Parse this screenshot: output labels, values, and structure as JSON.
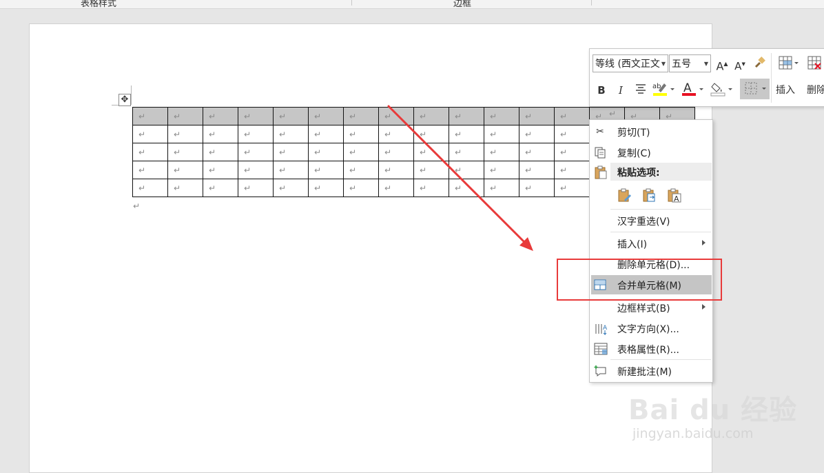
{
  "ribbon": {
    "group_table_styles": "表格样式",
    "group_borders": "边框"
  },
  "document": {
    "move_handle_icon": "move-icon",
    "paragraph_mark": "↵",
    "table_rows": 5,
    "table_cols": 16,
    "selected_row": 1
  },
  "mini_toolbar": {
    "font_name": "等线 (西文正文",
    "font_size": "五号",
    "grow_font": "A",
    "shrink_font": "A",
    "bold": "B",
    "italic": "I",
    "font_color_letter": "A",
    "insert_label": "插入",
    "delete_label": "删除"
  },
  "context_menu": {
    "items": [
      {
        "label": "剪切(T)",
        "icon": "cut-icon"
      },
      {
        "label": "复制(C)",
        "icon": "copy-icon"
      },
      {
        "label": "粘贴选项:",
        "icon": "paste-icon"
      },
      {
        "label": "汉字重选(V)",
        "icon": ""
      },
      {
        "label": "插入(I)",
        "icon": "",
        "submenu": true
      },
      {
        "label": "删除单元格(D)...",
        "icon": ""
      },
      {
        "label": "合并单元格(M)",
        "icon": "merge-cells-icon",
        "highlighted": true
      },
      {
        "label": "边框样式(B)",
        "icon": "",
        "submenu": true
      },
      {
        "label": "文字方向(X)...",
        "icon": "text-direction-icon"
      },
      {
        "label": "表格属性(R)...",
        "icon": "table-properties-icon"
      },
      {
        "label": "新建批注(M)",
        "icon": "new-comment-icon"
      }
    ]
  },
  "watermark": {
    "brand": "Bai  du 经验",
    "url": "jingyan.baidu.com"
  },
  "colors": {
    "highlight_yellow": "#ffff00",
    "font_red": "#e81123",
    "annotation_red": "#e83a3a",
    "selection_gray": "#c6c6c6"
  }
}
